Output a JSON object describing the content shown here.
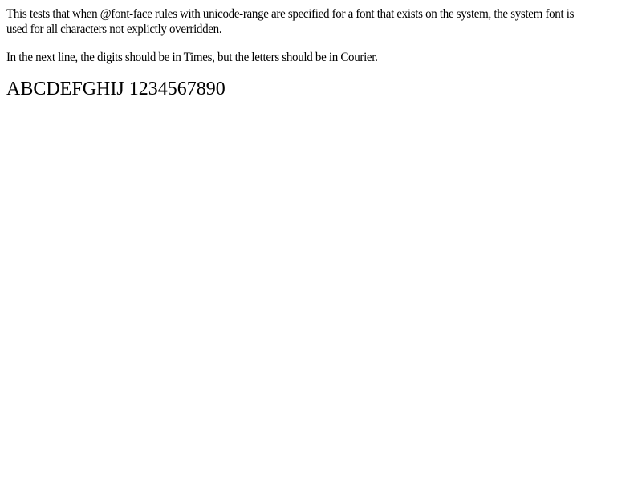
{
  "intro_text": "This tests that when @font-face rules with unicode-range are specified for a font that exists on the system, the system font is used for all characters not explictly overridden.",
  "instruction_text": "In the next line, the digits should be in Times, but the letters should be in Courier.",
  "sample": {
    "letters": "ABCDEFGHIJ",
    "separator": " ",
    "digits": "1234567890"
  }
}
